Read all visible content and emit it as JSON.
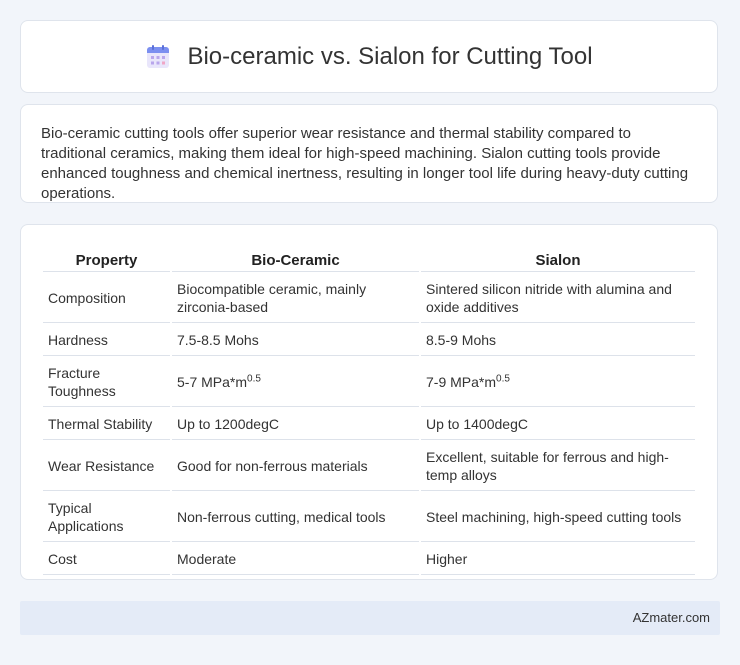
{
  "header": {
    "title": "Bio-ceramic vs. Sialon for Cutting Tool",
    "icon": "calendar-icon",
    "icon_colors": {
      "top": "#7b8ff0",
      "body": "#e9e6fb",
      "grid": "#b9a6ec"
    }
  },
  "intro": {
    "text": "Bio-ceramic cutting tools offer superior wear resistance and thermal stability compared to traditional ceramics, making them ideal for high-speed machining. Sialon cutting tools provide enhanced toughness and chemical inertness, resulting in longer tool life during heavy-duty cutting operations."
  },
  "table": {
    "headers": [
      "Property",
      "Bio-Ceramic",
      "Sialon"
    ],
    "rows": [
      {
        "property": "Composition",
        "bio": "Biocompatible ceramic, mainly zirconia-based",
        "sialon": "Sintered silicon nitride with alumina and oxide additives"
      },
      {
        "property": "Hardness",
        "bio": "7.5-8.5 Mohs",
        "sialon": "8.5-9 Mohs"
      },
      {
        "property": "Fracture Toughness",
        "bio": "5-7 MPa*m",
        "bio_sup": "0.5",
        "sialon": "7-9 MPa*m",
        "sialon_sup": "0.5"
      },
      {
        "property": "Thermal Stability",
        "bio": "Up to 1200degC",
        "sialon": "Up to 1400degC"
      },
      {
        "property": "Wear Resistance",
        "bio": "Good for non-ferrous materials",
        "sialon": "Excellent, suitable for ferrous and high-temp alloys"
      },
      {
        "property": "Typical Applications",
        "bio": "Non-ferrous cutting, medical tools",
        "sialon": "Steel machining, high-speed cutting tools"
      },
      {
        "property": "Cost",
        "bio": "Moderate",
        "sialon": "Higher"
      }
    ]
  },
  "footer": {
    "text": "AZmater.com"
  }
}
